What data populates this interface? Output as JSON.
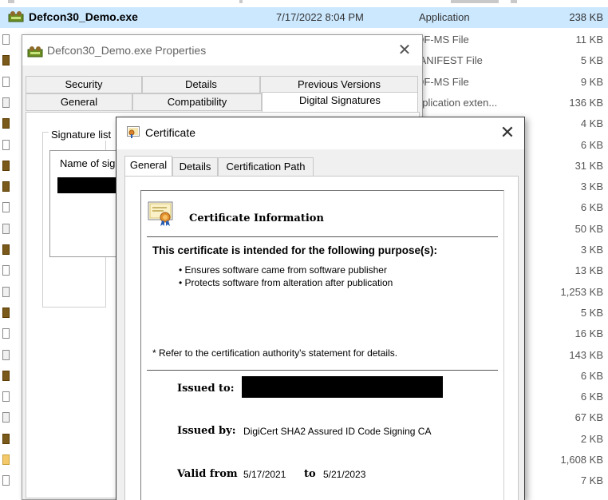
{
  "explorer": {
    "selected": {
      "name": "Defcon30_Demo.exe",
      "date": "7/17/2022 8:04 PM",
      "type": "Application",
      "size": "238 KB"
    },
    "rows": [
      {
        "type": "DF-MS File",
        "size": "11 KB",
        "icon": "doc"
      },
      {
        "type": "IANIFEST File",
        "size": "5 KB",
        "icon": "exe"
      },
      {
        "type": "DF-MS File",
        "size": "9 KB",
        "icon": "doc"
      },
      {
        "type": "pplication exten...",
        "size": "136 KB",
        "icon": "gear"
      },
      {
        "type": "",
        "size": "4 KB",
        "icon": "exe"
      },
      {
        "type": "",
        "size": "6 KB",
        "icon": "doc"
      },
      {
        "type": "",
        "size": "31 KB",
        "icon": "exe"
      },
      {
        "type": "",
        "size": "3 KB",
        "icon": "exe"
      },
      {
        "type": "",
        "size": "6 KB",
        "icon": "doc"
      },
      {
        "type": "",
        "size": "50 KB",
        "icon": "gear"
      },
      {
        "type": "",
        "size": "3 KB",
        "icon": "exe"
      },
      {
        "type": "",
        "size": "13 KB",
        "icon": "doc"
      },
      {
        "type": "",
        "size": "1,253 KB",
        "icon": "gear"
      },
      {
        "type": "",
        "size": "5 KB",
        "icon": "exe"
      },
      {
        "type": "",
        "size": "16 KB",
        "icon": "doc"
      },
      {
        "type": "",
        "size": "143 KB",
        "icon": "gear"
      },
      {
        "type": "",
        "size": "6 KB",
        "icon": "exe"
      },
      {
        "type": "",
        "size": "6 KB",
        "icon": "doc"
      },
      {
        "type": "",
        "size": "67 KB",
        "icon": "gear"
      },
      {
        "type": "",
        "size": "2 KB",
        "icon": "exe"
      },
      {
        "type": "",
        "size": "1,608 KB",
        "icon": "folder"
      },
      {
        "type": "",
        "size": "7 KB",
        "icon": "doc"
      }
    ]
  },
  "properties": {
    "title": "Defcon30_Demo.exe Properties",
    "close": "✕",
    "tabs_row1": [
      "Security",
      "Details",
      "Previous Versions"
    ],
    "tabs_row2": [
      "General",
      "Compatibility",
      "Digital Signatures"
    ],
    "signature_list_label": "Signature list",
    "name_column": "Name of sig"
  },
  "certificate": {
    "title": "Certificate",
    "close": "✕",
    "tabs": [
      "General",
      "Details",
      "Certification Path"
    ],
    "info_heading": "Certificate Information",
    "purpose_heading": "This certificate is intended for the following purpose(s):",
    "purposes": [
      "• Ensures software came from software publisher",
      "• Protects software from alteration after publication"
    ],
    "note": "* Refer to the certification authority's statement for details.",
    "issued_to_label": "Issued to:",
    "issued_by_label": "Issued by:",
    "issued_by_value": "DigiCert SHA2 Assured ID Code Signing CA",
    "valid_from_label": "Valid from",
    "valid_from_value": "5/17/2021",
    "to_label": "to",
    "valid_to_value": "5/21/2023"
  }
}
